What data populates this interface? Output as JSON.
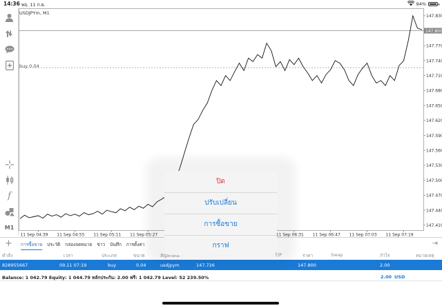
{
  "status_bar": {
    "time": "14:36",
    "date": "พฤ. 11 ก.ย.",
    "battery": "94%"
  },
  "toolbar": {
    "icons": [
      "user-icon",
      "trade-icon",
      "chat-icon",
      "add-document-icon",
      "crosshair-icon",
      "candles-icon",
      "function-icon",
      "objects-icon"
    ],
    "timeframe": "M1"
  },
  "chart": {
    "symbol_label": "USDJPYm, M1",
    "order_label": "buy 0.04",
    "bid_price_badge": "147.800",
    "price_ticks": [
      "147.830",
      "147.800",
      "147.770",
      "147.740",
      "147.710",
      "147.680",
      "147.650",
      "147.620",
      "147.590",
      "147.560",
      "147.530",
      "147.500",
      "147.470",
      "147.440",
      "147.410"
    ],
    "time_ticks": [
      "11 Sep 04:39",
      "11 Sep 04:55",
      "11 Sep 05:11",
      "11 Sep 05:27",
      "11 Sep 06:31",
      "11 Sep 06:47",
      "11 Sep 07:03",
      "11 Sep 07:19"
    ],
    "colors": {
      "line": "#111111",
      "grid": "#c8c8c8",
      "badge": "#888888"
    }
  },
  "chart_data": {
    "type": "line",
    "title": "USDJPYm, M1",
    "series": [
      {
        "name": "USDJPYm",
        "x": [
          "04:31",
          "04:33",
          "04:35",
          "04:37",
          "04:39",
          "04:41",
          "04:43",
          "04:45",
          "04:47",
          "04:49",
          "04:51",
          "04:53",
          "04:55",
          "04:57",
          "04:59",
          "05:01",
          "05:03",
          "05:05",
          "05:07",
          "05:09",
          "05:11",
          "05:13",
          "05:15",
          "05:17",
          "05:19",
          "05:21",
          "05:23",
          "05:25",
          "05:27",
          "05:29",
          "05:31",
          "05:33",
          "05:35",
          "05:37",
          "05:39",
          "05:41",
          "05:43",
          "05:45",
          "05:47",
          "05:49",
          "05:51",
          "05:53",
          "05:55",
          "05:57",
          "05:59",
          "06:01",
          "06:03",
          "06:05",
          "06:07",
          "06:09",
          "06:11",
          "06:13",
          "06:15",
          "06:17",
          "06:19",
          "06:21",
          "06:23",
          "06:25",
          "06:27",
          "06:29",
          "06:31",
          "06:33",
          "06:35",
          "06:37",
          "06:39",
          "06:41",
          "06:43",
          "06:45",
          "06:47",
          "06:49",
          "06:51",
          "06:53",
          "06:55",
          "06:57",
          "06:59",
          "07:01",
          "07:03",
          "07:05",
          "07:07",
          "07:09",
          "07:11",
          "07:13",
          "07:15",
          "07:17",
          "07:19",
          "07:21",
          "07:23",
          "07:25",
          "07:27"
        ],
        "y": [
          147.423,
          147.43,
          147.425,
          147.427,
          147.429,
          147.424,
          147.432,
          147.428,
          147.431,
          147.426,
          147.433,
          147.429,
          147.432,
          147.428,
          147.435,
          147.431,
          147.433,
          147.438,
          147.432,
          147.44,
          147.437,
          147.435,
          147.443,
          147.439,
          147.446,
          147.441,
          147.448,
          147.444,
          147.452,
          147.447,
          147.457,
          147.462,
          147.468,
          147.48,
          147.5,
          147.525,
          147.555,
          147.585,
          147.612,
          147.622,
          147.64,
          147.655,
          147.68,
          147.7,
          147.69,
          147.71,
          147.7,
          147.718,
          147.735,
          147.72,
          147.745,
          147.738,
          147.752,
          147.745,
          147.775,
          147.76,
          147.728,
          147.738,
          147.72,
          147.742,
          147.732,
          147.745,
          147.728,
          147.715,
          147.7,
          147.71,
          147.695,
          147.712,
          147.722,
          147.74,
          147.735,
          147.722,
          147.7,
          147.69,
          147.712,
          147.725,
          147.735,
          147.71,
          147.695,
          147.7,
          147.69,
          147.71,
          147.7,
          147.73,
          147.74,
          147.78,
          147.83,
          147.805,
          147.802
        ],
        "color": "#111111"
      }
    ],
    "xlabel": "",
    "ylabel": "",
    "ylim": [
      147.4,
      147.845
    ],
    "grid": false,
    "horizontal_lines": [
      {
        "label": "buy 0.04",
        "value": 147.726
      },
      {
        "label": "",
        "value": 147.8
      }
    ]
  },
  "popup_menu": {
    "items": [
      "ปิด",
      "ปรับเปลี่ยน",
      "การซื้อขาย",
      "กราฟ"
    ]
  },
  "bottom_tabs": {
    "items": [
      "การซื้อขาย",
      "ประวัติ",
      "กล่องจดหมาย",
      "ข่าว",
      "บันทึก",
      "การตั้งค่า"
    ],
    "active_index": 0
  },
  "table": {
    "headers": {
      "order": "คำสั่ง",
      "time": "เวลา",
      "type": "ประเภท",
      "volume": "ขนาด",
      "symbol": "สัญลักษณ์",
      "tp": "T/P",
      "price": "ราคา",
      "swap": "Swap",
      "profit": "กำไร",
      "comment": "หมายเหตุ"
    },
    "row": {
      "order": "828955667",
      "time": "09.11 07:19",
      "type": "buy",
      "volume": "0.04",
      "symbol": "usdjpym",
      "open_price": "147.726",
      "price": "147.800",
      "profit": "2.00"
    }
  },
  "balance": {
    "text": "Balance: 1 042.79 Equity: 1 044.79 หลักประกัน: 2.00 ฟรี: 1 042.79 Level: 52 239.50%",
    "amount": "2.00",
    "currency": "USD"
  }
}
